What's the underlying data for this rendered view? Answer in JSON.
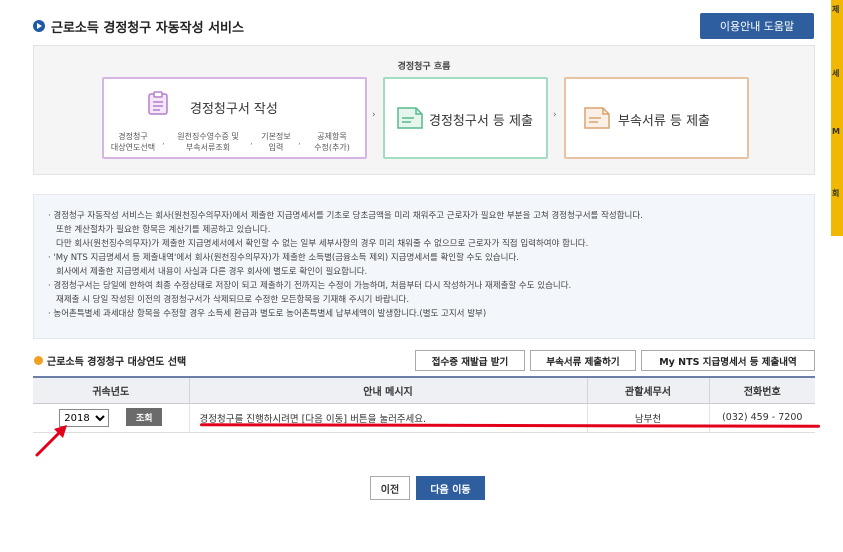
{
  "header": {
    "title": "근로소득 경정청구 자동작성 서비스",
    "help_label": "이용안내 도움말"
  },
  "right_bar": [
    "제",
    "세",
    "M",
    "회"
  ],
  "flow": {
    "title": "경정청구 흐름",
    "step1": {
      "title": "경정청구서 작성",
      "subs": [
        [
          "경정청구",
          "대상연도선택"
        ],
        [
          "원천징수영수증 및",
          "부속서류조회"
        ],
        [
          "기본정보",
          "입력"
        ],
        [
          "공제항목",
          "수정(추가)"
        ]
      ]
    },
    "step2": {
      "title": "경정청구서 등 제출"
    },
    "step3": {
      "title": "부속서류 등 제출"
    },
    "arrow": "›",
    "sub_sep": ","
  },
  "notice": [
    "· 경정청구 자동작성 서비스는 회사(원천징수의무자)에서 제출한 지급명세서를 기초로 당초금액을 미리 채워주고 근로자가 필요한 부분을 고쳐 경정청구서를 작성합니다.",
    "또한 계산절차가 필요한 항목은 계산기를 제공하고 있습니다.",
    "다만 회사(원천징수의무자)가 제출한 지급명세서에서 확인할 수 없는 일부 세부사항의 경우 미리 채워줄 수 없으므로 근로자가 직접 입력하여야 합니다.",
    "· 'My NTS 지급명세서 등 제출내역'에서 회사(원천징수의무자)가 제출한 소득별(금융소득 제외) 지급명세서를 확인할 수도 있습니다.",
    "회사에서 제출한 지급명세서 내용이 사실과 다른 경우 회사에 별도로 확인이 필요합니다.",
    "· 경정청구서는 당일에 한하여 최종 수정상태로 저장이 되고 제출하기 전까지는 수정이 가능하며, 처음부터 다시 작성하거나 재제출할 수도 있습니다.",
    "재제출 시 당일 작성된 이전의 경정청구서가 삭제되므로 수정한 모든항목을 기재해 주시기 바랍니다.",
    "· 농어촌특별세 과세대상 항목을 수정할 경우 소득세 환급과 별도로 농어촌특별세 납부세액이 발생합니다.(별도 고지서 발부)"
  ],
  "section": {
    "title": "근로소득 경정청구 대상연도 선택",
    "buttons": [
      "접수증 재발급 받기",
      "부속서류 제출하기",
      "My NTS 지급명세서 등 제출내역"
    ]
  },
  "table": {
    "headers": [
      "귀속년도",
      "안내 메시지",
      "관할세무서",
      "전화번호"
    ],
    "row": {
      "year": "2018",
      "query_label": "조회",
      "message": "경정청구를 진행하시려면 [다음 이동] 버튼을 눌러주세요.",
      "office": "남부천",
      "phone": "(032) 459 - 7200"
    }
  },
  "nav": {
    "prev_label": "이전",
    "next_label": "다음 이동"
  },
  "colors": {
    "accent": "#2f5e9e",
    "annotation": "#e3001b"
  }
}
